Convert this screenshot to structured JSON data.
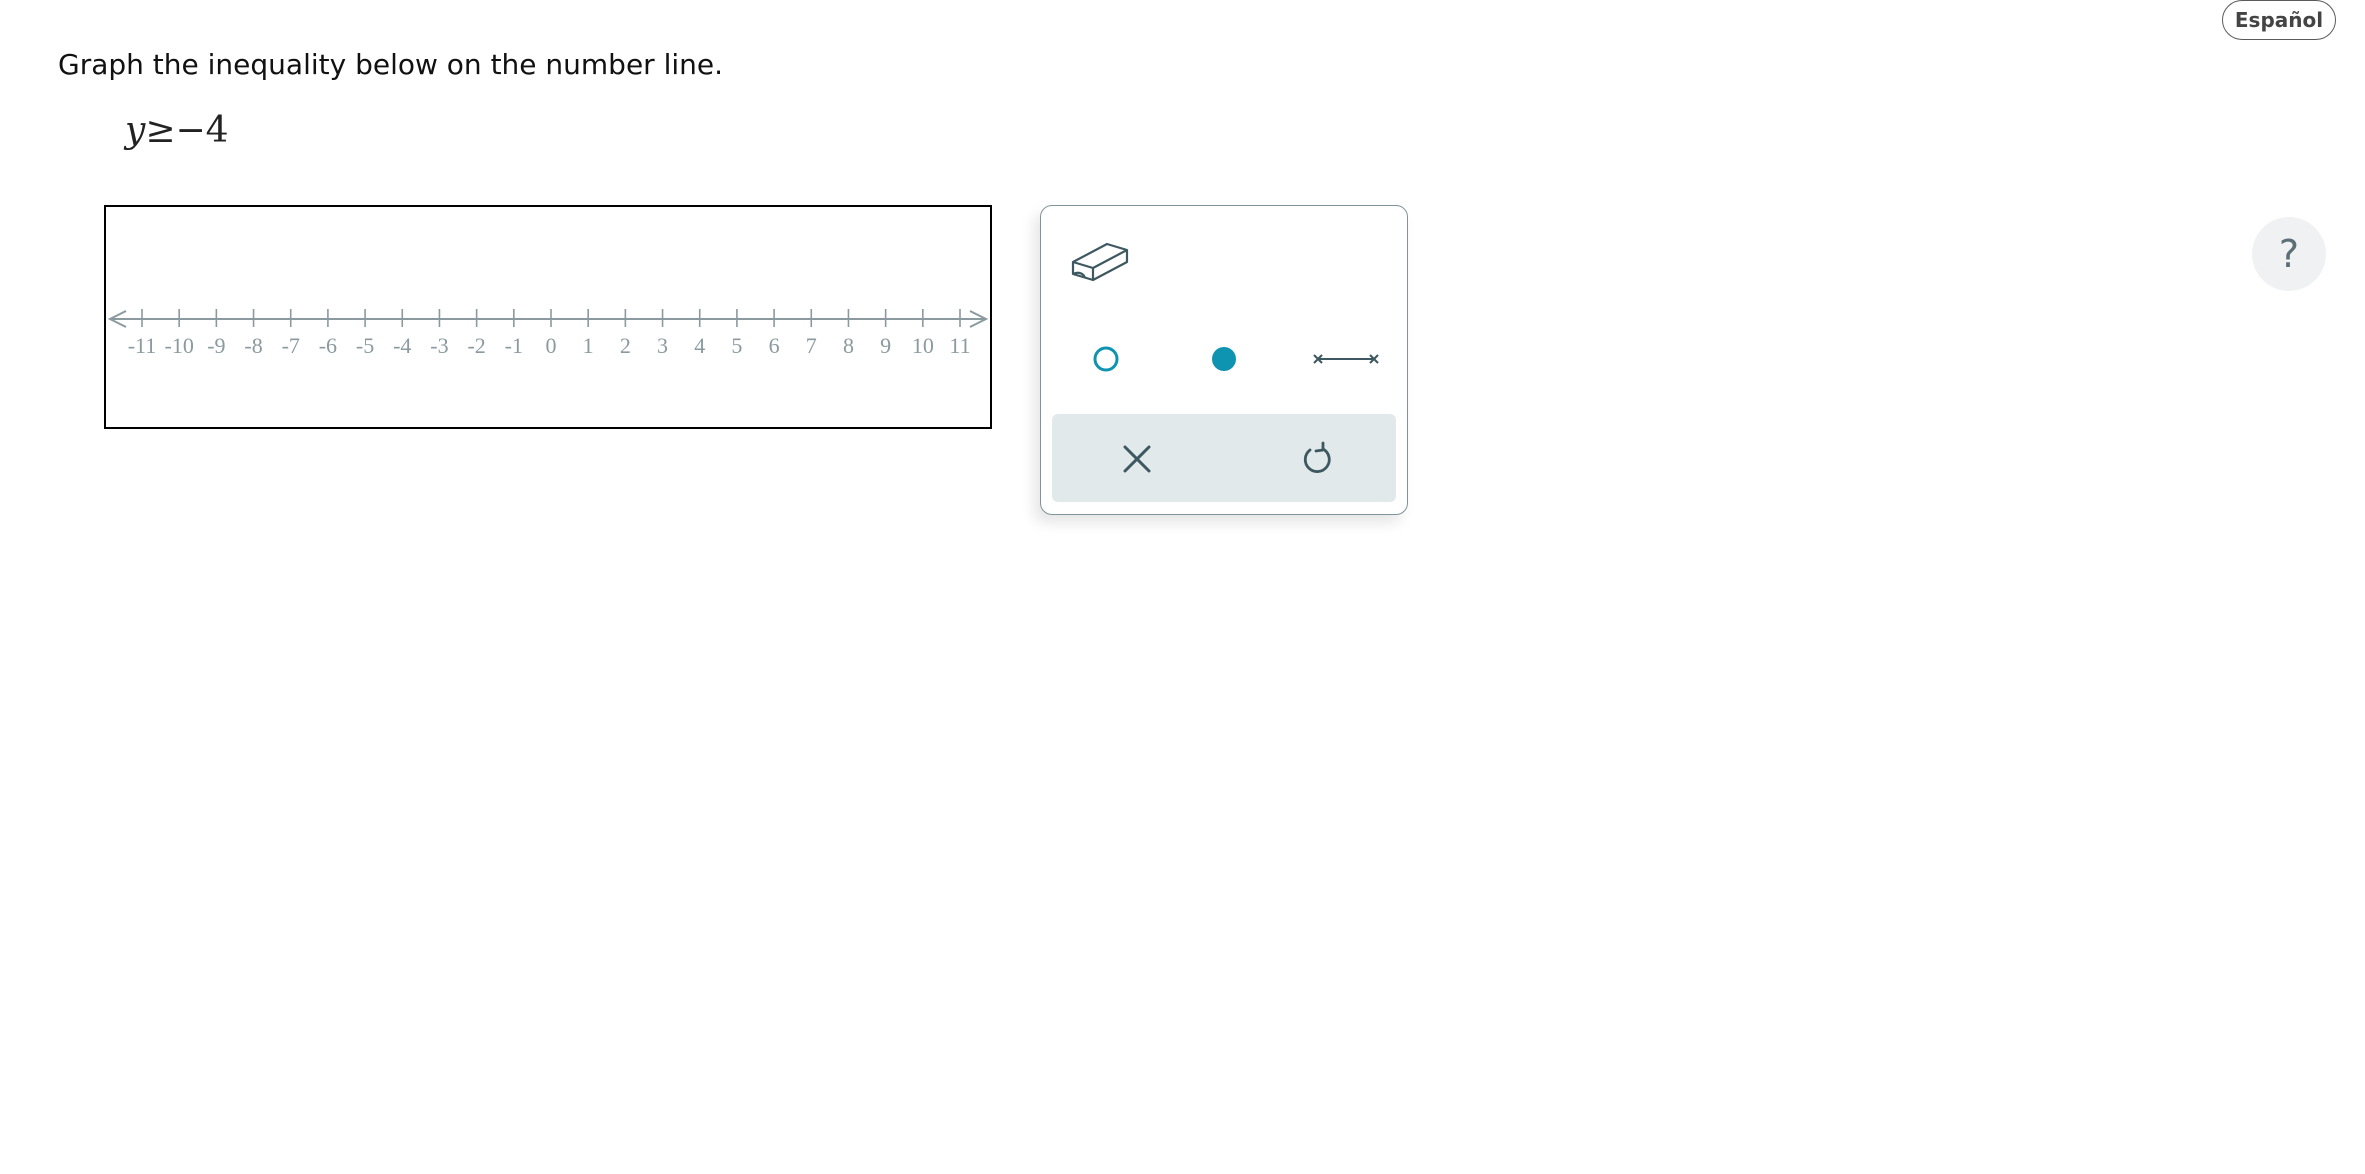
{
  "header": {
    "language_button": "Español"
  },
  "problem": {
    "instructions": "Graph the inequality below on the number line.",
    "inequality_variable": "y",
    "inequality_rest": "≥−4"
  },
  "number_line": {
    "min": -11,
    "max": 11,
    "tick_labels": [
      "-11",
      "-10",
      "-9",
      "-8",
      "-7",
      "-6",
      "-5",
      "-4",
      "-3",
      "-2",
      "-1",
      "0",
      "1",
      "2",
      "3",
      "4",
      "5",
      "6",
      "7",
      "8",
      "9",
      "10",
      "11"
    ],
    "line_color": "#8a9a9f"
  },
  "toolbox": {
    "tools": [
      {
        "name": "eraser",
        "icon": "eraser-icon"
      },
      {
        "name": "open-dot",
        "icon": "open-circle-icon"
      },
      {
        "name": "closed-dot",
        "icon": "filled-circle-icon"
      },
      {
        "name": "segment",
        "icon": "segment-icon"
      }
    ],
    "actions": [
      {
        "name": "clear",
        "icon": "x-icon"
      },
      {
        "name": "undo",
        "icon": "undo-icon"
      }
    ],
    "accent_color": "#0e93b0",
    "icon_color": "#3d5860"
  },
  "help": {
    "label": "?"
  }
}
